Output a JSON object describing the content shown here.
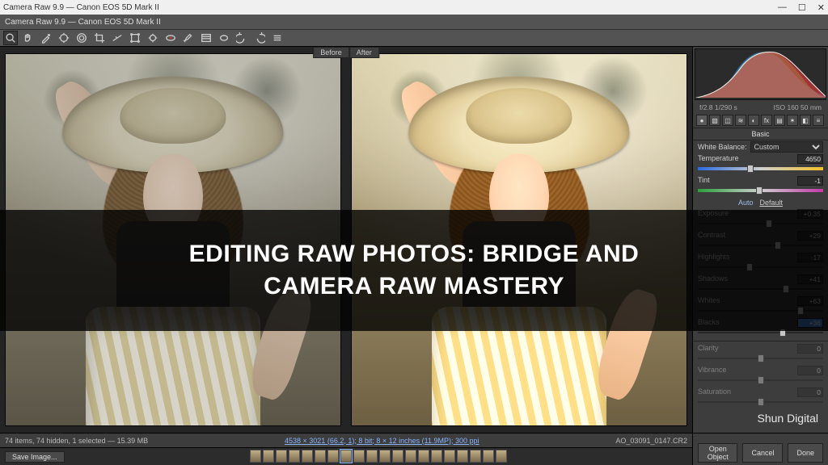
{
  "window": {
    "title": "Camera Raw 9.9 — Canon EOS 5D Mark II",
    "min": "—",
    "max": "☐",
    "close": "✕"
  },
  "preview": {
    "before": "Before",
    "after": "After"
  },
  "metaline": {
    "left": "f/2.8   1/290 s",
    "right": "ISO 160   50 mm"
  },
  "panelTabs": [
    "●",
    "▧",
    "◫",
    "≋",
    "◐",
    "fx",
    "▤",
    "✶",
    "◧",
    "≡"
  ],
  "section": "Basic",
  "wb": {
    "label": "White Balance:",
    "value": "Custom"
  },
  "autoLabel": "Auto",
  "defaultLabel": "Default",
  "sliders": {
    "temperature": {
      "label": "Temperature",
      "value": "4650",
      "pct": 42,
      "grad": "linear-gradient(90deg,#2a6adf,#cfcfcf,#f2c22a)"
    },
    "tint": {
      "label": "Tint",
      "value": "-1",
      "pct": 49,
      "grad": "linear-gradient(90deg,#29a03a,#cfcfcf,#c23aa8)"
    },
    "exposure": {
      "label": "Exposure",
      "value": "+0.35",
      "pct": 57
    },
    "contrast": {
      "label": "Contrast",
      "value": "+29",
      "pct": 64
    },
    "highlights": {
      "label": "Highlights",
      "value": "-17",
      "pct": 41
    },
    "shadows": {
      "label": "Shadows",
      "value": "+41",
      "pct": 70
    },
    "whites": {
      "label": "Whites",
      "value": "+63",
      "pct": 82
    },
    "blacks": {
      "label": "Blacks",
      "value": "+36",
      "pct": 68,
      "hi": true
    },
    "clarity": {
      "label": "Clarity",
      "value": "0",
      "pct": 50
    },
    "vibrance": {
      "label": "Vibrance",
      "value": "0",
      "pct": 50
    },
    "saturation": {
      "label": "Saturation",
      "value": "0",
      "pct": 50
    }
  },
  "overlay": {
    "line1": "EDITING RAW PHOTOS: BRIDGE AND",
    "line2": "CAMERA RAW MASTERY"
  },
  "watermark": "Shun Digital",
  "infobar": {
    "filecount": "74 items, 74 hidden, 1 selected — 15.39 MB",
    "filename": "AO_03091_0147.CR2",
    "details": "4538 × 3021 (66.2, 1); 8 bit; 8 × 12 inches (11.9MP); 300 ppi"
  },
  "buttons": {
    "saveImage": "Save Image...",
    "openObject": "Open Object",
    "cancel": "Cancel",
    "done": "Done"
  },
  "colors": {
    "panel": "#3d3d3d",
    "accent": "#4f8ff0"
  }
}
